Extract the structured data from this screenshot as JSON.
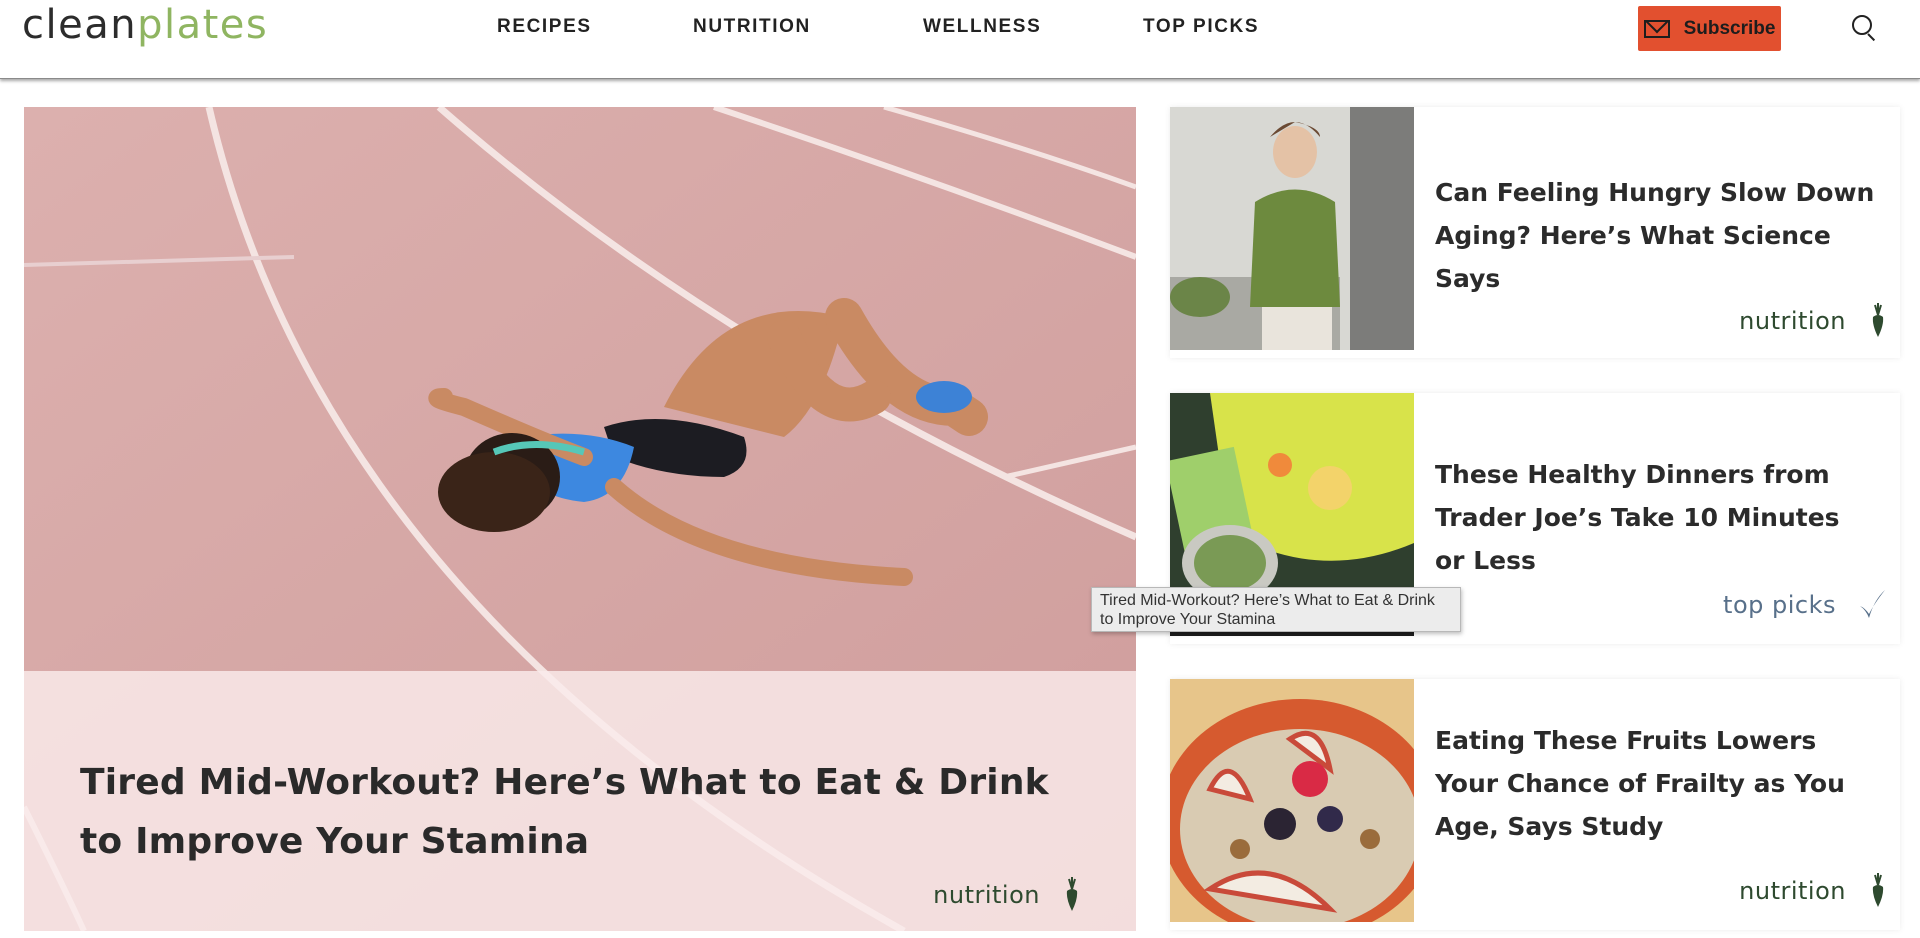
{
  "header": {
    "logo_clean": "clean",
    "logo_plates": "plates",
    "nav": [
      "RECIPES",
      "NUTRITION",
      "WELLNESS",
      "TOP PICKS"
    ],
    "subscribe_label": "Subscribe"
  },
  "hero": {
    "title": "Tired Mid-Workout? Here’s What to Eat & Drink to Improve Your Stamina",
    "tag": "nutrition"
  },
  "cards": [
    {
      "title": "Can Feeling Hungry Slow Down Aging? Here’s What Science Says",
      "tag": "nutrition",
      "tag_icon": "carrot-icon"
    },
    {
      "title": "These Healthy Dinners from Trader Joe’s Take 10 Minutes or Less",
      "tag": "top picks",
      "tag_icon": "checkmark-icon"
    },
    {
      "title": "Eating These Fruits Lowers Your Chance of Frailty as You Age, Says Study",
      "tag": "nutrition",
      "tag_icon": "carrot-icon"
    }
  ],
  "tooltip": {
    "text": "Tired Mid-Workout? Here’s What to Eat & Drink to Improve Your Stamina"
  },
  "colors": {
    "accent": "#e2502f",
    "logo_green": "#8fb561",
    "tag_green": "#2e4a2f",
    "tag_blue": "#58708a"
  }
}
